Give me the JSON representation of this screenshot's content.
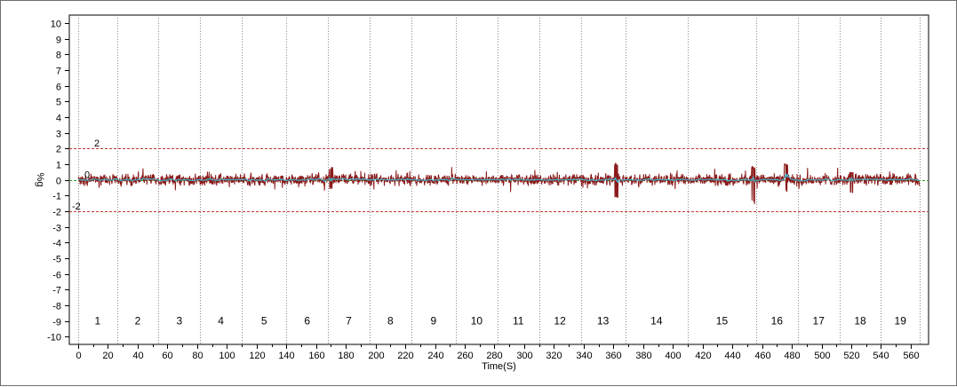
{
  "chart_data": {
    "type": "line",
    "title": "",
    "xlabel": "Time(S)",
    "ylabel": "%g",
    "xlim": [
      -6,
      572
    ],
    "ylim": [
      -10.5,
      10.5
    ],
    "x_ticks": [
      0,
      20,
      40,
      60,
      80,
      100,
      120,
      140,
      160,
      180,
      200,
      220,
      240,
      260,
      280,
      300,
      320,
      340,
      360,
      380,
      400,
      420,
      440,
      460,
      480,
      500,
      520,
      540,
      560
    ],
    "y_ticks": [
      10,
      9,
      8,
      7,
      6,
      5,
      4,
      3,
      2,
      1,
      0,
      -1,
      -2,
      -3,
      -4,
      -5,
      -6,
      -7,
      -8,
      -9,
      -10
    ],
    "grid": false,
    "thresholds": [
      {
        "value": 2,
        "label": "2",
        "color": "#c0392b"
      },
      {
        "value": 0,
        "label": "0",
        "color": "#2e9e2e"
      },
      {
        "value": -2,
        "label": "-2",
        "color": "#c0392b"
      }
    ],
    "segment_boundaries": [
      0,
      26,
      54,
      82,
      110,
      140,
      168,
      196,
      224,
      254,
      282,
      310,
      338,
      368,
      410,
      456,
      484,
      512,
      540,
      566
    ],
    "segments": [
      {
        "label": "1",
        "center": 13
      },
      {
        "label": "2",
        "center": 40
      },
      {
        "label": "3",
        "center": 68
      },
      {
        "label": "4",
        "center": 96
      },
      {
        "label": "5",
        "center": 125
      },
      {
        "label": "6",
        "center": 154
      },
      {
        "label": "7",
        "center": 182
      },
      {
        "label": "8",
        "center": 210
      },
      {
        "label": "9",
        "center": 239
      },
      {
        "label": "10",
        "center": 268
      },
      {
        "label": "11",
        "center": 296
      },
      {
        "label": "12",
        "center": 324
      },
      {
        "label": "13",
        "center": 353
      },
      {
        "label": "14",
        "center": 389
      },
      {
        "label": "15",
        "center": 433
      },
      {
        "label": "16",
        "center": 470
      },
      {
        "label": "17",
        "center": 498
      },
      {
        "label": "18",
        "center": 526
      },
      {
        "label": "19",
        "center": 553
      }
    ],
    "series": [
      {
        "kind": "acceleration-trace",
        "color": "#8b1a1a",
        "x_start": 0,
        "x_end": 566,
        "typical_amplitude": 0.35,
        "peaks": [
          {
            "x": 362,
            "max": 1.1,
            "min": -1.2
          },
          {
            "x": 454,
            "max": 0.9,
            "min": -1.6
          },
          {
            "x": 476,
            "max": 1.1,
            "min": -0.8
          },
          {
            "x": 170,
            "max": 0.8,
            "min": -0.6
          },
          {
            "x": 520,
            "max": 0.5,
            "min": -0.9
          }
        ]
      },
      {
        "kind": "smoothed-trace",
        "color": "#40b4c8",
        "x_start": 0,
        "x_end": 566
      }
    ]
  }
}
